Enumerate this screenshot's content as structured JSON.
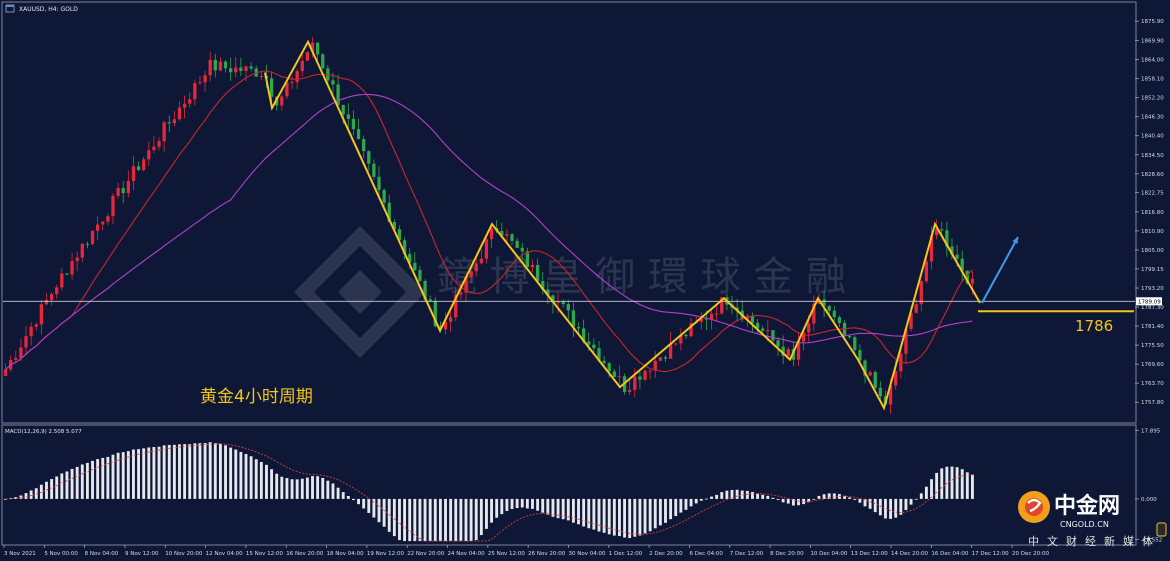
{
  "window": {
    "title": "XAUUSD, H4:  GOLD",
    "indicator_label": "MACD(12,26,9) 2.508 5.077"
  },
  "annotations": {
    "period_label": "黄金4小时周期",
    "support_label": "1786",
    "watermark_text": "鏡 博 皇 御 環 球 金 融",
    "logo_text": "中金网",
    "logo_url": "CNGOLD.CN",
    "logo_tagline": "中文财经新媒体"
  },
  "colors": {
    "background": "#0e1836",
    "bull_candle": "#e8283a",
    "bear_candle": "#2ea84c",
    "ma_fast": "#c8262f",
    "ma_slow": "#b540c8",
    "zigzag": "#f5c518",
    "forecast_arrow": "#3d9be9",
    "price_line": "#c7ccd9",
    "macd_bars": "#e6e8ee",
    "macd_signal": "#d04040"
  },
  "chart_data": {
    "type": "candlestick",
    "symbol": "XAUUSD",
    "timeframe": "H4",
    "ylim": [
      1752.6,
      1880.3
    ],
    "y_ticks": [
      "1875.90",
      "1869.90",
      "1864.00",
      "1858.10",
      "1852.20",
      "1846.30",
      "1840.40",
      "1834.50",
      "1828.60",
      "1822.75",
      "1816.80",
      "1810.90",
      "1805.00",
      "1799.15",
      "1793.20",
      "1787.30",
      "1781.40",
      "1775.50",
      "1769.60",
      "1763.70",
      "1757.80"
    ],
    "current_price": "1789.09",
    "x_ticks": [
      "3 Nov 2021",
      "5 Nov 00:00",
      "8 Nov 04:00",
      "9 Nov 12:00",
      "10 Nov 20:00",
      "12 Nov 04:00",
      "15 Nov 12:00",
      "16 Nov 20:00",
      "18 Nov 04:00",
      "19 Nov 12:00",
      "22 Nov 20:00",
      "24 Nov 04:00",
      "25 Nov 12:00",
      "26 Nov 20:00",
      "30 Nov 04:00",
      "1 Dec 12:00",
      "2 Dec 20:00",
      "6 Dec 04:00",
      "7 Dec 12:00",
      "8 Dec 20:00",
      "10 Dec 04:00",
      "13 Dec 12:00",
      "14 Dec 20:00",
      "16 Dec 04:00",
      "17 Dec 12:00",
      "20 Dec 20:00"
    ],
    "zigzag_path": [
      1860,
      1849,
      1869.5,
      1780,
      1813,
      1762.5,
      1790,
      1771,
      1790,
      1771,
      1756,
      1813,
      1788.6
    ],
    "forecast_target": 1809,
    "support_level": 1786,
    "macd": {
      "ylim": [
        -11.5,
        18.5
      ],
      "y_ticks": [
        "17.895",
        "0.000",
        "-10.552"
      ],
      "value": 2.508,
      "signal": 5.077
    }
  }
}
